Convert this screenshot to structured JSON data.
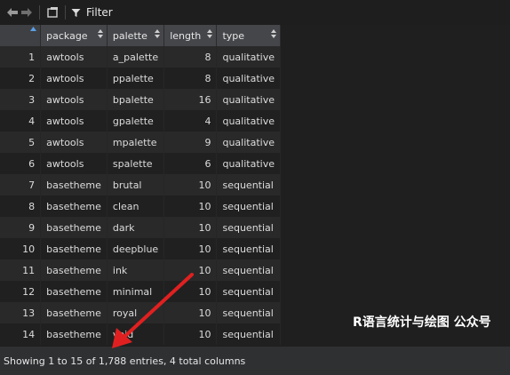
{
  "toolbar": {
    "back_icon": "arrow-left-icon",
    "forward_icon": "arrow-right-icon",
    "popout_icon": "popout-icon",
    "filter_icon": "funnel-icon",
    "filter_label": "Filter"
  },
  "table": {
    "columns": [
      "package",
      "palette",
      "length",
      "type"
    ],
    "rows": [
      {
        "index": "1",
        "package": "awtools",
        "palette": "a_palette",
        "length": "8",
        "type": "qualitative"
      },
      {
        "index": "2",
        "package": "awtools",
        "palette": "ppalette",
        "length": "8",
        "type": "qualitative"
      },
      {
        "index": "3",
        "package": "awtools",
        "palette": "bpalette",
        "length": "16",
        "type": "qualitative"
      },
      {
        "index": "4",
        "package": "awtools",
        "palette": "gpalette",
        "length": "4",
        "type": "qualitative"
      },
      {
        "index": "5",
        "package": "awtools",
        "palette": "mpalette",
        "length": "9",
        "type": "qualitative"
      },
      {
        "index": "6",
        "package": "awtools",
        "palette": "spalette",
        "length": "6",
        "type": "qualitative"
      },
      {
        "index": "7",
        "package": "basetheme",
        "palette": "brutal",
        "length": "10",
        "type": "sequential"
      },
      {
        "index": "8",
        "package": "basetheme",
        "palette": "clean",
        "length": "10",
        "type": "sequential"
      },
      {
        "index": "9",
        "package": "basetheme",
        "palette": "dark",
        "length": "10",
        "type": "sequential"
      },
      {
        "index": "10",
        "package": "basetheme",
        "palette": "deepblue",
        "length": "10",
        "type": "sequential"
      },
      {
        "index": "11",
        "package": "basetheme",
        "palette": "ink",
        "length": "10",
        "type": "sequential"
      },
      {
        "index": "12",
        "package": "basetheme",
        "palette": "minimal",
        "length": "10",
        "type": "sequential"
      },
      {
        "index": "13",
        "package": "basetheme",
        "palette": "royal",
        "length": "10",
        "type": "sequential"
      },
      {
        "index": "14",
        "package": "basetheme",
        "palette": "void",
        "length": "10",
        "type": "sequential"
      }
    ]
  },
  "status": {
    "text": "Showing 1 to 15 of 1,788 entries, 4 total columns"
  },
  "watermark": {
    "text": "R语言统计与绘图 公众号"
  },
  "colors": {
    "accent_sort": "#5aa0e6",
    "annotation_arrow": "#e02020"
  }
}
